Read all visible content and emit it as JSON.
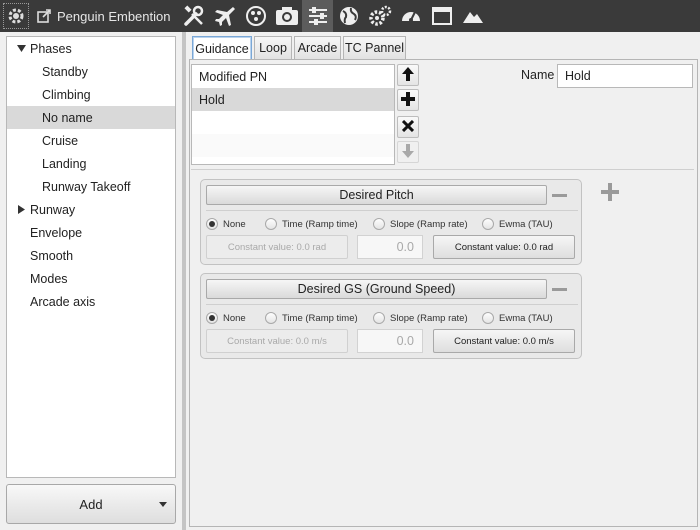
{
  "toolbar": {
    "title": "Penguin Embention",
    "icons": [
      "settings-gear-icon",
      "external-link-icon",
      "tools-icon",
      "airplane-icon",
      "nodes-icon",
      "camera-icon",
      "sliders-icon",
      "globe-icon",
      "gears-icon",
      "gauge-icon",
      "window-icon",
      "mountain-icon"
    ],
    "active_icon": "sliders-icon"
  },
  "sidebar": {
    "items": [
      {
        "label": "Phases",
        "level": 0,
        "expanded": true
      },
      {
        "label": "Standby",
        "level": 1
      },
      {
        "label": "Climbing",
        "level": 1
      },
      {
        "label": "No name",
        "level": 1,
        "selected": true
      },
      {
        "label": "Cruise",
        "level": 1
      },
      {
        "label": "Landing",
        "level": 1
      },
      {
        "label": "Runway Takeoff",
        "level": 1
      },
      {
        "label": "Runway",
        "level": 0,
        "expanded": false
      },
      {
        "label": "Envelope",
        "level": 0
      },
      {
        "label": "Smooth",
        "level": 0
      },
      {
        "label": "Modes",
        "level": 0
      },
      {
        "label": "Arcade axis",
        "level": 0
      }
    ],
    "add_label": "Add"
  },
  "tabs": [
    {
      "label": "Guidance",
      "active": true
    },
    {
      "label": "Loop"
    },
    {
      "label": "Arcade"
    },
    {
      "label": "TC Pannel"
    }
  ],
  "guidance": {
    "list": [
      {
        "label": "Modified PN"
      },
      {
        "label": "Hold",
        "selected": true
      },
      {
        "label": ""
      },
      {
        "label": ""
      }
    ],
    "name_label": "Name",
    "name_value": "Hold"
  },
  "groups": [
    {
      "title": "Desired Pitch",
      "options": [
        "None",
        "Time (Ramp time)",
        "Slope (Ramp rate)",
        "Ewma (TAU)"
      ],
      "selected_option": "None",
      "constant_disabled": "Constant value: 0.0 rad",
      "value": "0.0",
      "constant_button": "Constant value: 0.0 rad"
    },
    {
      "title": "Desired GS (Ground Speed)",
      "options": [
        "None",
        "Time (Ramp time)",
        "Slope (Ramp rate)",
        "Ewma (TAU)"
      ],
      "selected_option": "None",
      "constant_disabled": "Constant value: 0.0 m/s",
      "value": "0.0",
      "constant_button": "Constant value: 0.0 m/s"
    }
  ],
  "colors": {
    "toolbar_bg": "#3a3a3a",
    "selection_bg": "#d9d9d9",
    "active_tab_border": "#7aa7d6"
  }
}
